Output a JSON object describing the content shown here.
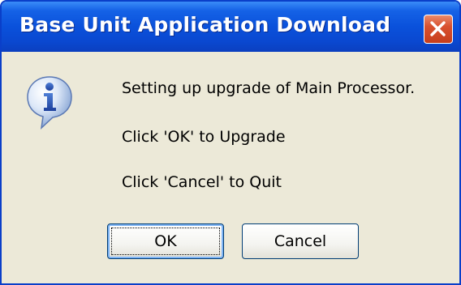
{
  "window": {
    "title": "Base Unit Application Download",
    "close_label": "Close"
  },
  "message": {
    "icon": "info-icon",
    "line1": "Setting up upgrade of Main Processor.",
    "line2": "Click 'OK' to Upgrade",
    "line3": "Click 'Cancel' to Quit"
  },
  "buttons": {
    "ok_label": "OK",
    "cancel_label": "Cancel"
  },
  "colors": {
    "titlebar": "#0a51db",
    "dialog_background": "#ece9d8",
    "close_button": "#d9512f"
  }
}
